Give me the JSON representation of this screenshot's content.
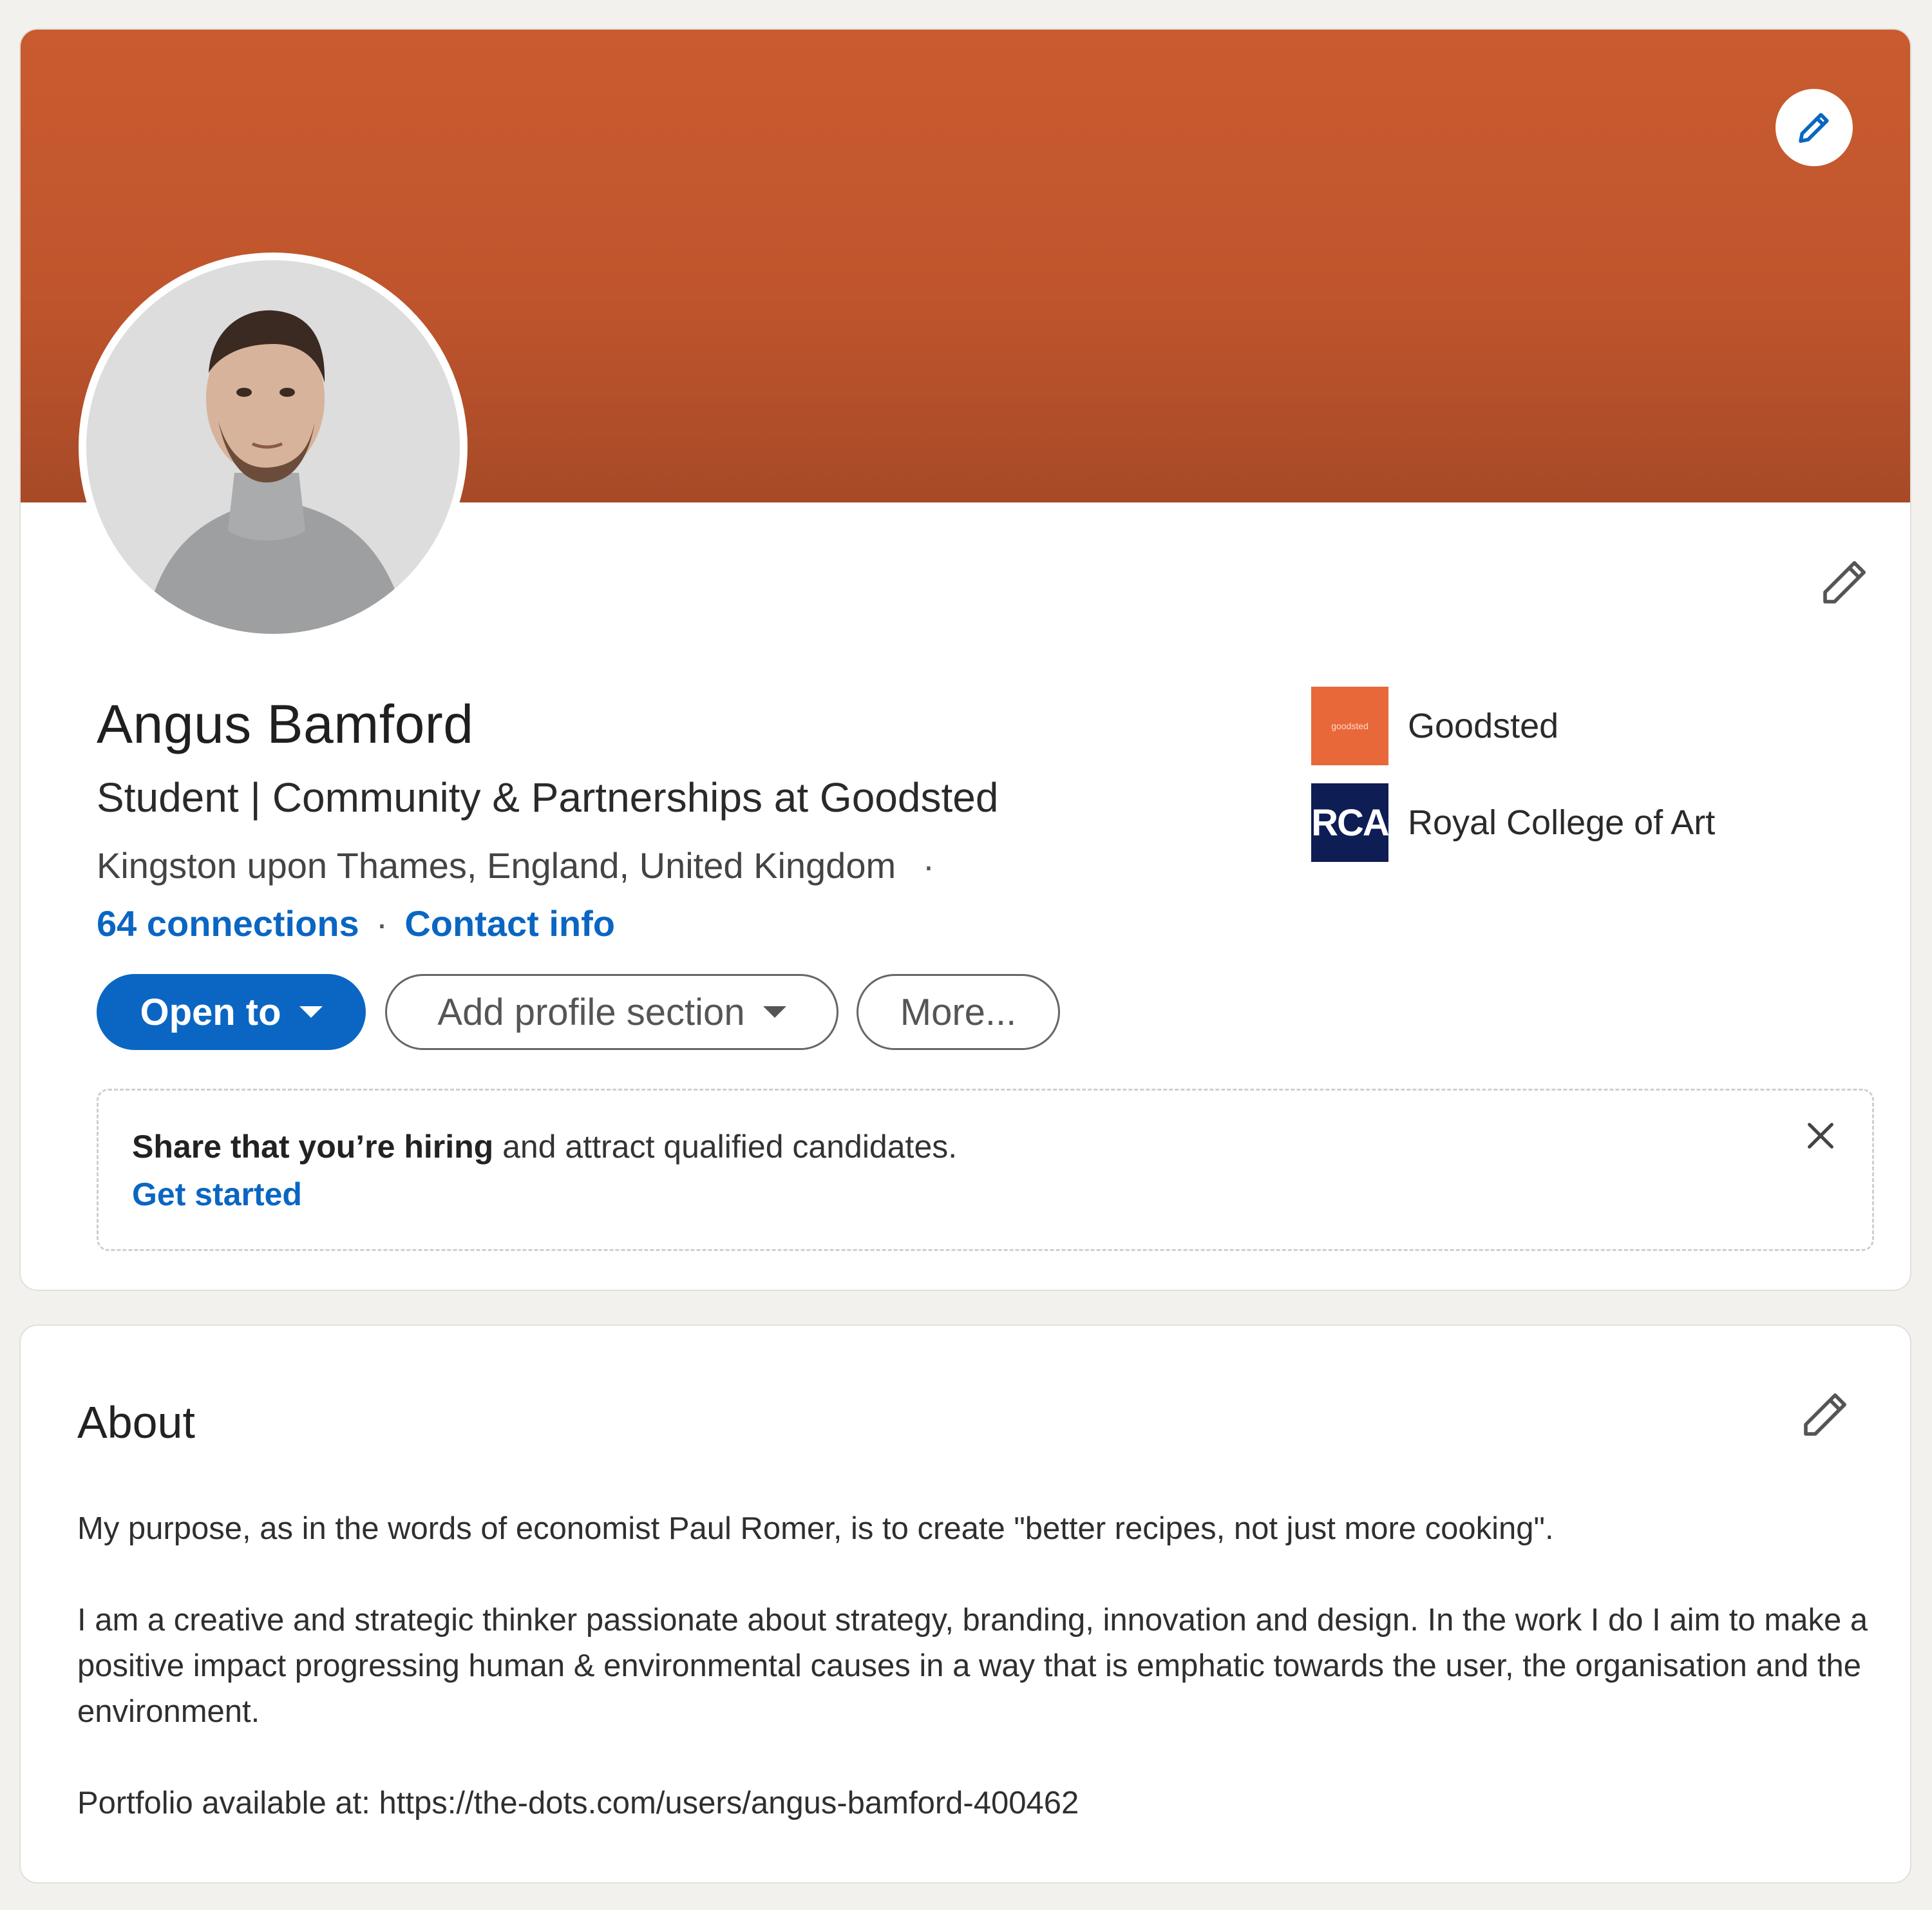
{
  "colors": {
    "accent": "#0a66c2",
    "cover": "#c0552d",
    "goodsted_logo": "#e8683a",
    "rca_logo": "#0f1d55"
  },
  "profile": {
    "name": "Angus Bamford",
    "headline": "Student | Community & Partnerships at Goodsted",
    "location": "Kingston upon Thames, England, United Kingdom",
    "location_separator": "·",
    "connections": "64 connections",
    "links_separator": "·",
    "contact_info": "Contact info"
  },
  "icons": {
    "cover_edit": "pencil-icon",
    "intro_edit": "pencil-icon",
    "hiring_close": "close-icon",
    "about_edit": "pencil-icon"
  },
  "buttons": {
    "open_to": "Open to",
    "add_section": "Add profile section",
    "more": "More..."
  },
  "hiring": {
    "bold_text": "Share that you’re hiring",
    "rest_text": " and attract qualified candidates.",
    "cta": "Get started"
  },
  "orgs": [
    {
      "name": "Goodsted",
      "logo_text": "goodsted"
    },
    {
      "name": "Royal College of Art",
      "logo_text": "RCA"
    }
  ],
  "about": {
    "title": "About",
    "paragraphs": [
      "My purpose, as in the words of economist Paul Romer, is to create \"better recipes, not just more cooking\".",
      "I am a creative and strategic thinker passionate about strategy, branding, innovation and design. In the work I do I aim to make a positive impact progressing human & environmental causes in a way that is emphatic towards the user, the organisation and the environment.",
      "Portfolio available at: https://the-dots.com/users/angus-bamford-400462"
    ]
  }
}
